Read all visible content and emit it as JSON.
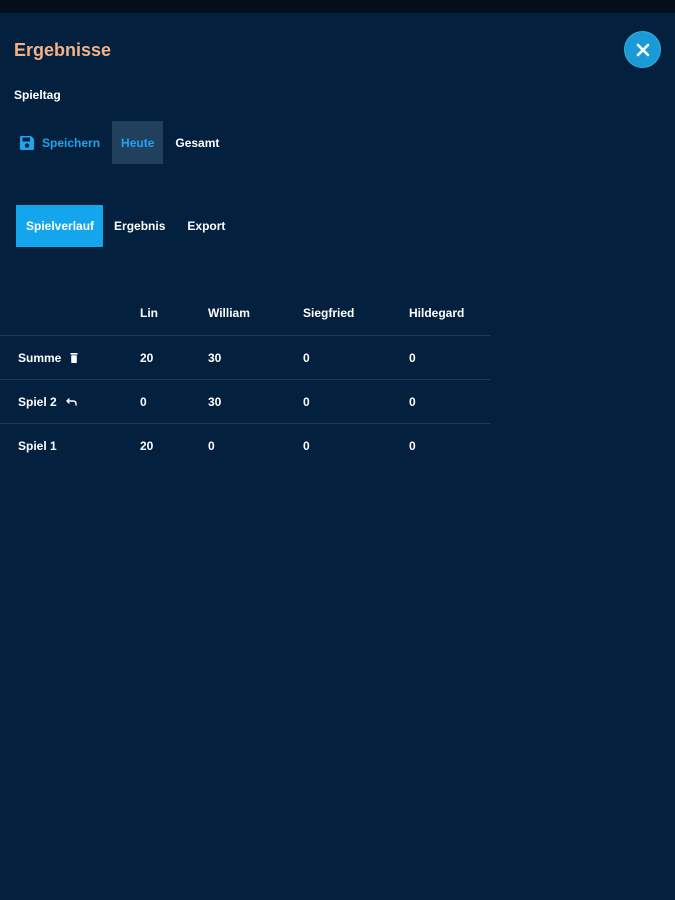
{
  "header": {
    "title": "Ergebnisse",
    "close_icon": "close-icon"
  },
  "section": {
    "label": "Spieltag"
  },
  "toolbar": {
    "save_label": "Speichern",
    "save_icon": "floppy-disk-icon",
    "today_label": "Heute",
    "total_label": "Gesamt",
    "selected": "Heute"
  },
  "tabs": {
    "items": [
      "Spielverlauf",
      "Ergebnis",
      "Export"
    ],
    "active": "Spielverlauf"
  },
  "table": {
    "columns": [
      "",
      "Lin",
      "William",
      "Siegfried",
      "Hildegard"
    ],
    "rows": [
      {
        "label": "Summe",
        "icon": "trash-icon",
        "values": [
          "20",
          "30",
          "0",
          "0"
        ]
      },
      {
        "label": "Spiel 2",
        "icon": "undo-icon",
        "values": [
          "0",
          "30",
          "0",
          "0"
        ]
      },
      {
        "label": "Spiel 1",
        "icon": "",
        "values": [
          "20",
          "0",
          "0",
          "0"
        ]
      }
    ]
  },
  "colors": {
    "background": "#03203f",
    "title": "#f3b187",
    "accent": "#13a6ec",
    "selected_bg": "#20405e"
  }
}
